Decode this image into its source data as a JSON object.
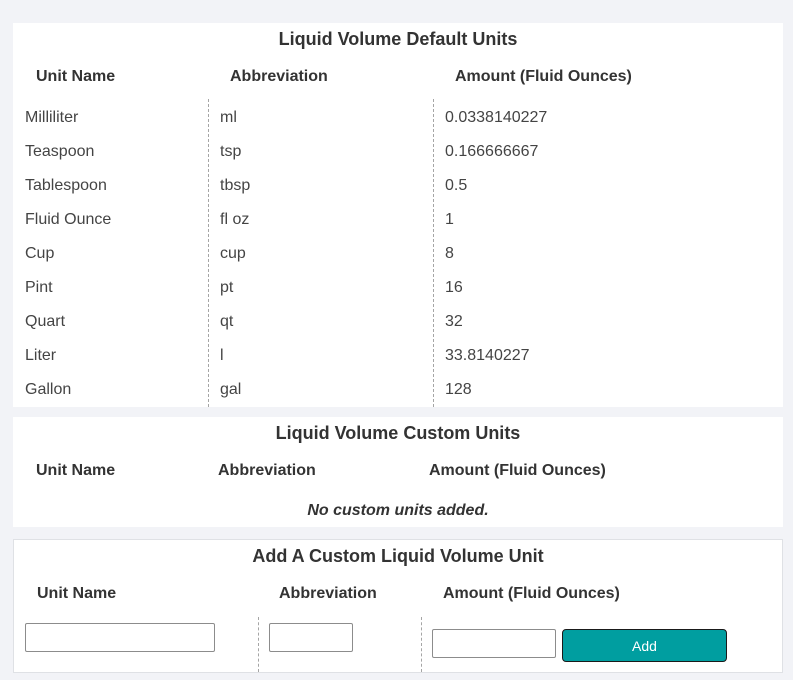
{
  "default_units": {
    "title": "Liquid Volume Default Units",
    "headers": {
      "name": "Unit Name",
      "abbr": "Abbreviation",
      "amount": "Amount (Fluid Ounces)"
    },
    "rows": [
      {
        "name": "Milliliter",
        "abbr": "ml",
        "amount": "0.0338140227"
      },
      {
        "name": "Teaspoon",
        "abbr": "tsp",
        "amount": "0.166666667"
      },
      {
        "name": "Tablespoon",
        "abbr": "tbsp",
        "amount": "0.5"
      },
      {
        "name": "Fluid Ounce",
        "abbr": "fl oz",
        "amount": "1"
      },
      {
        "name": "Cup",
        "abbr": "cup",
        "amount": "8"
      },
      {
        "name": "Pint",
        "abbr": "pt",
        "amount": "16"
      },
      {
        "name": "Quart",
        "abbr": "qt",
        "amount": "32"
      },
      {
        "name": "Liter",
        "abbr": "l",
        "amount": "33.8140227"
      },
      {
        "name": "Gallon",
        "abbr": "gal",
        "amount": "128"
      }
    ]
  },
  "custom_units": {
    "title": "Liquid Volume Custom Units",
    "headers": {
      "name": "Unit Name",
      "abbr": "Abbreviation",
      "amount": "Amount (Fluid Ounces)"
    },
    "empty_message": "No custom units added."
  },
  "add_form": {
    "title": "Add A Custom Liquid Volume Unit",
    "headers": {
      "name": "Unit Name",
      "abbr": "Abbreviation",
      "amount": "Amount (Fluid Ounces)"
    },
    "name_value": "",
    "abbr_value": "",
    "amount_value": "",
    "add_label": "Add"
  }
}
